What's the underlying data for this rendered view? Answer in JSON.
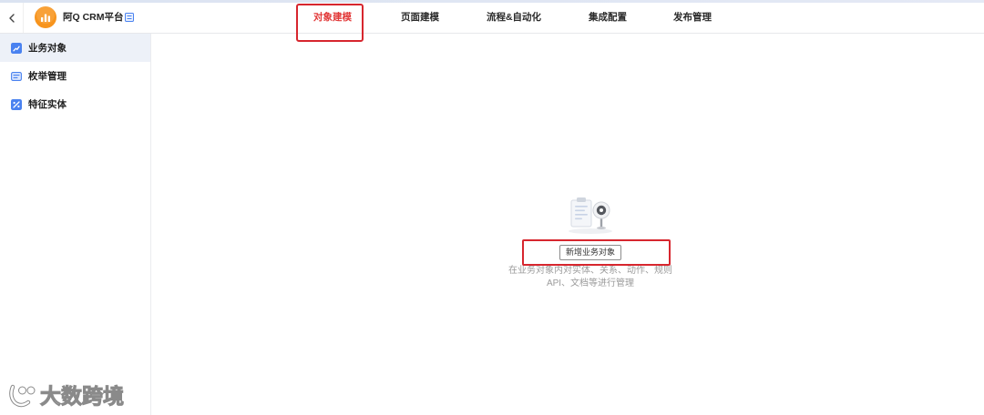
{
  "app": {
    "title": "阿Q CRM平台",
    "back_icon": "chevron-left-icon",
    "logo_icon": "bar-chart-icon",
    "badge_icon": "list-icon"
  },
  "top_nav": {
    "tabs": [
      {
        "label": "对象建模",
        "active": true
      },
      {
        "label": "页面建模",
        "active": false
      },
      {
        "label": "流程&自动化",
        "active": false
      },
      {
        "label": "集成配置",
        "active": false
      },
      {
        "label": "发布管理",
        "active": false
      }
    ]
  },
  "sidebar": {
    "items": [
      {
        "label": "业务对象",
        "icon": "trend-square-icon",
        "selected": true
      },
      {
        "label": "枚举管理",
        "icon": "list-card-icon",
        "selected": false
      },
      {
        "label": "特征实体",
        "icon": "trend-square-icon",
        "selected": false
      }
    ]
  },
  "empty_state": {
    "illustration_icon": "empty-clipboard-illustration",
    "button_label": "新增业务对象",
    "description_lines": [
      "在业务对象内对实体、关系、动作、规则",
      "API、文档等进行管理"
    ]
  },
  "watermark": {
    "logo_icon": "watermark-logo-icon",
    "text": "大数跨境"
  },
  "colors": {
    "accent": "#4a82f0",
    "active_tab": "#e23b3b",
    "highlight": "#d7262e",
    "selected_bg": "#edf1f8",
    "logo": "#f7941d"
  }
}
